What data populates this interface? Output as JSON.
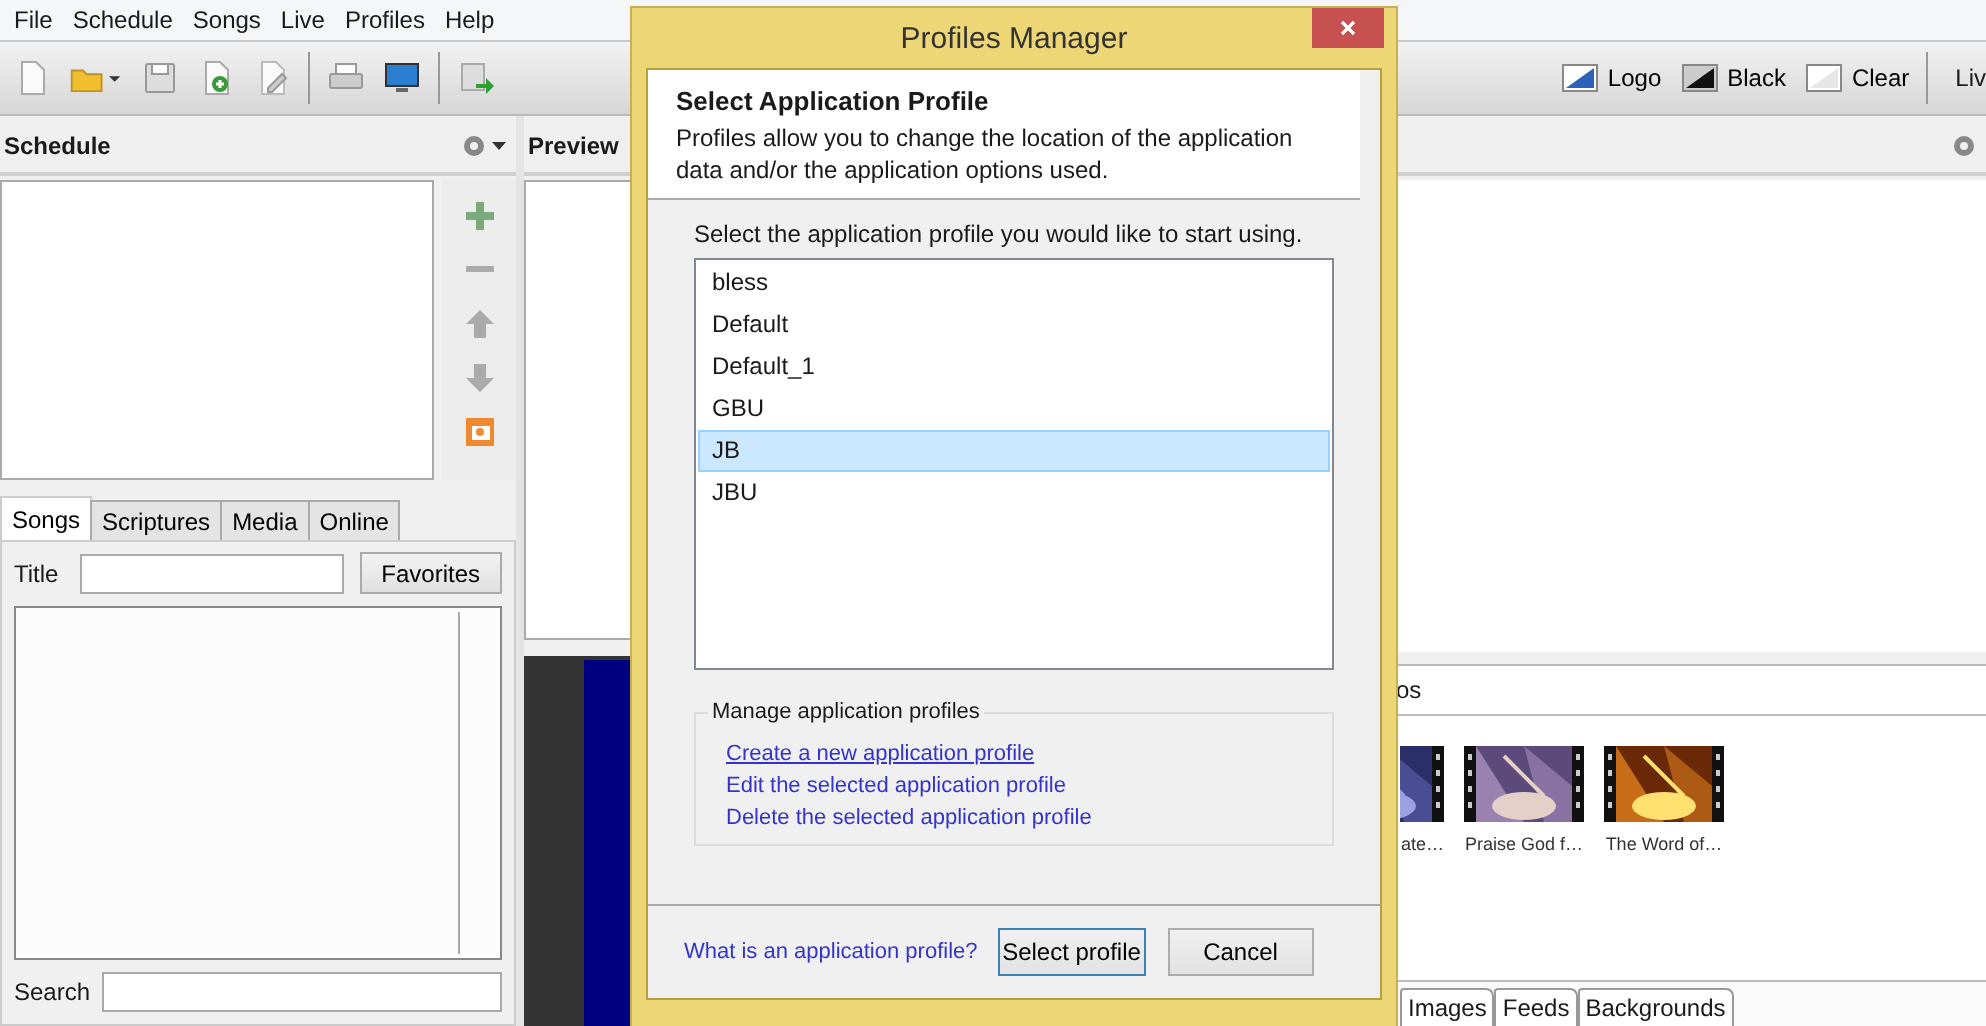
{
  "menu": [
    "File",
    "Schedule",
    "Songs",
    "Live",
    "Profiles",
    "Help"
  ],
  "toolbar": {
    "screens": [
      {
        "label": "Logo",
        "kind": "logo"
      },
      {
        "label": "Black",
        "kind": "black"
      },
      {
        "label": "Clear",
        "kind": "clear"
      }
    ],
    "live_label": "Liv"
  },
  "schedule": {
    "title": "Schedule"
  },
  "library": {
    "tabs": [
      {
        "label": "Songs",
        "selected": true
      },
      {
        "label": "Scriptures",
        "selected": false
      },
      {
        "label": "Media",
        "selected": false
      },
      {
        "label": "Online",
        "selected": false
      }
    ],
    "title_label": "Title",
    "favorites": "Favorites",
    "search_label": "Search"
  },
  "preview": {
    "title": "Preview"
  },
  "media": {
    "filter_text": "os",
    "items": [
      {
        "caption": "ate…",
        "kind": "picture"
      },
      {
        "caption": "Praise God f…",
        "kind": "picture"
      },
      {
        "caption": "The Word of…",
        "kind": "picture"
      }
    ],
    "tabs": [
      "Images",
      "Feeds",
      "Backgrounds"
    ]
  },
  "dialog": {
    "title": "Profiles Manager",
    "heading": "Select Application Profile",
    "description": "Profiles allow you to change the location of the application data and/or the application options used.",
    "prompt": "Select the application profile you would like to start using.",
    "profiles": [
      {
        "name": "bless",
        "selected": false
      },
      {
        "name": "Default",
        "selected": false
      },
      {
        "name": "Default_1",
        "selected": false
      },
      {
        "name": "GBU",
        "selected": false
      },
      {
        "name": "JB",
        "selected": true
      },
      {
        "name": "JBU",
        "selected": false
      }
    ],
    "manage": {
      "title": "Manage application profiles",
      "links": [
        {
          "label": "Create a new application profile",
          "focused": true
        },
        {
          "label": "Edit the selected application profile",
          "focused": false
        },
        {
          "label": "Delete the selected application profile",
          "focused": false
        }
      ]
    },
    "help_link": "What is an application profile?",
    "buttons": [
      {
        "label": "Select profile",
        "default": true
      },
      {
        "label": "Cancel",
        "default": false
      }
    ]
  }
}
